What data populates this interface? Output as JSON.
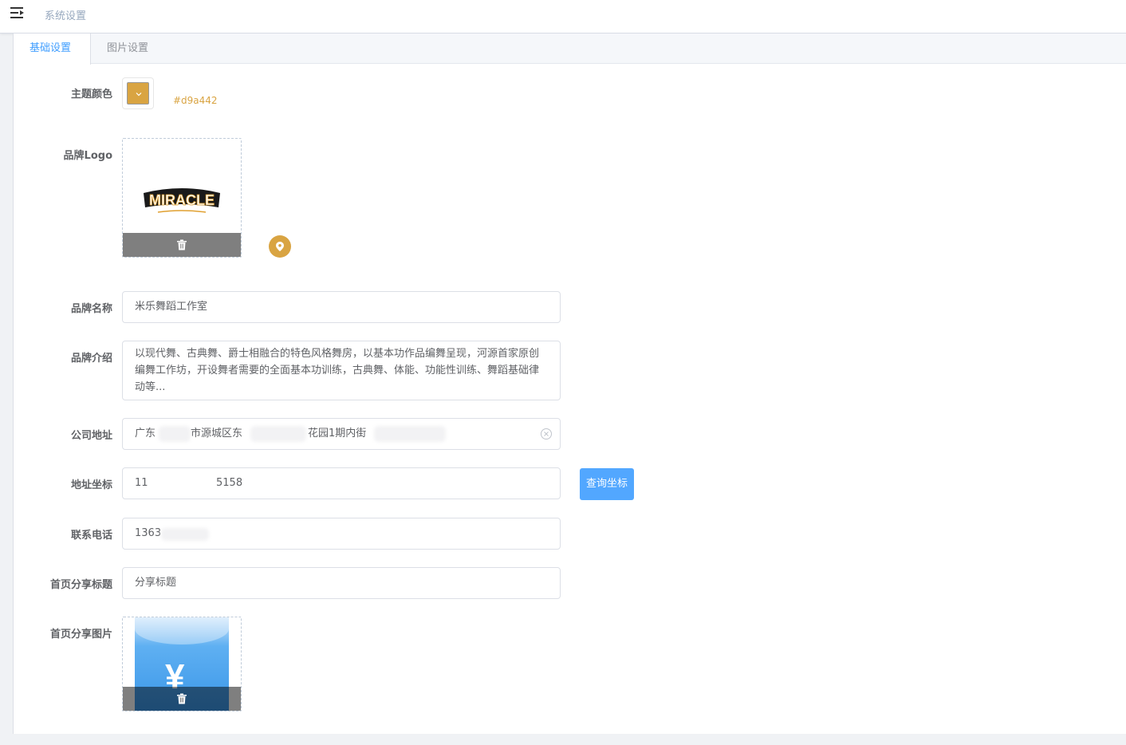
{
  "header": {
    "breadcrumb": "系统设置"
  },
  "tabs": [
    {
      "label": "基础设置",
      "active": true
    },
    {
      "label": "图片设置",
      "active": false
    }
  ],
  "form": {
    "theme_color": {
      "label": "主题颜色",
      "value": "#d9a442"
    },
    "brand_logo": {
      "label": "品牌Logo",
      "image_text": "MIRACLE"
    },
    "brand_name": {
      "label": "品牌名称",
      "value": "米乐舞蹈工作室"
    },
    "brand_intro": {
      "label": "品牌介绍",
      "value": "以现代舞、古典舞、爵士相融合的特色风格舞房，以基本功作品编舞呈现，河源首家原创编舞工作坊，开设舞者需要的全面基本功训练，古典舞、体能、功能性训练、舞蹈基础律动等..."
    },
    "address": {
      "label": "公司地址",
      "value_part1": "广东",
      "value_part2": "市源城区东",
      "value_part3": "花园1期内街"
    },
    "coords": {
      "label": "地址坐标",
      "value_part1": "11",
      "value_part2": "5158",
      "button": "查询坐标"
    },
    "phone": {
      "label": "联系电话",
      "value": "1363"
    },
    "share_title": {
      "label": "首页分享标题",
      "value": "分享标题"
    },
    "share_image": {
      "label": "首页分享图片",
      "image_text": "¥"
    }
  },
  "colors": {
    "accent": "#409eff",
    "theme": "#d9a442"
  }
}
